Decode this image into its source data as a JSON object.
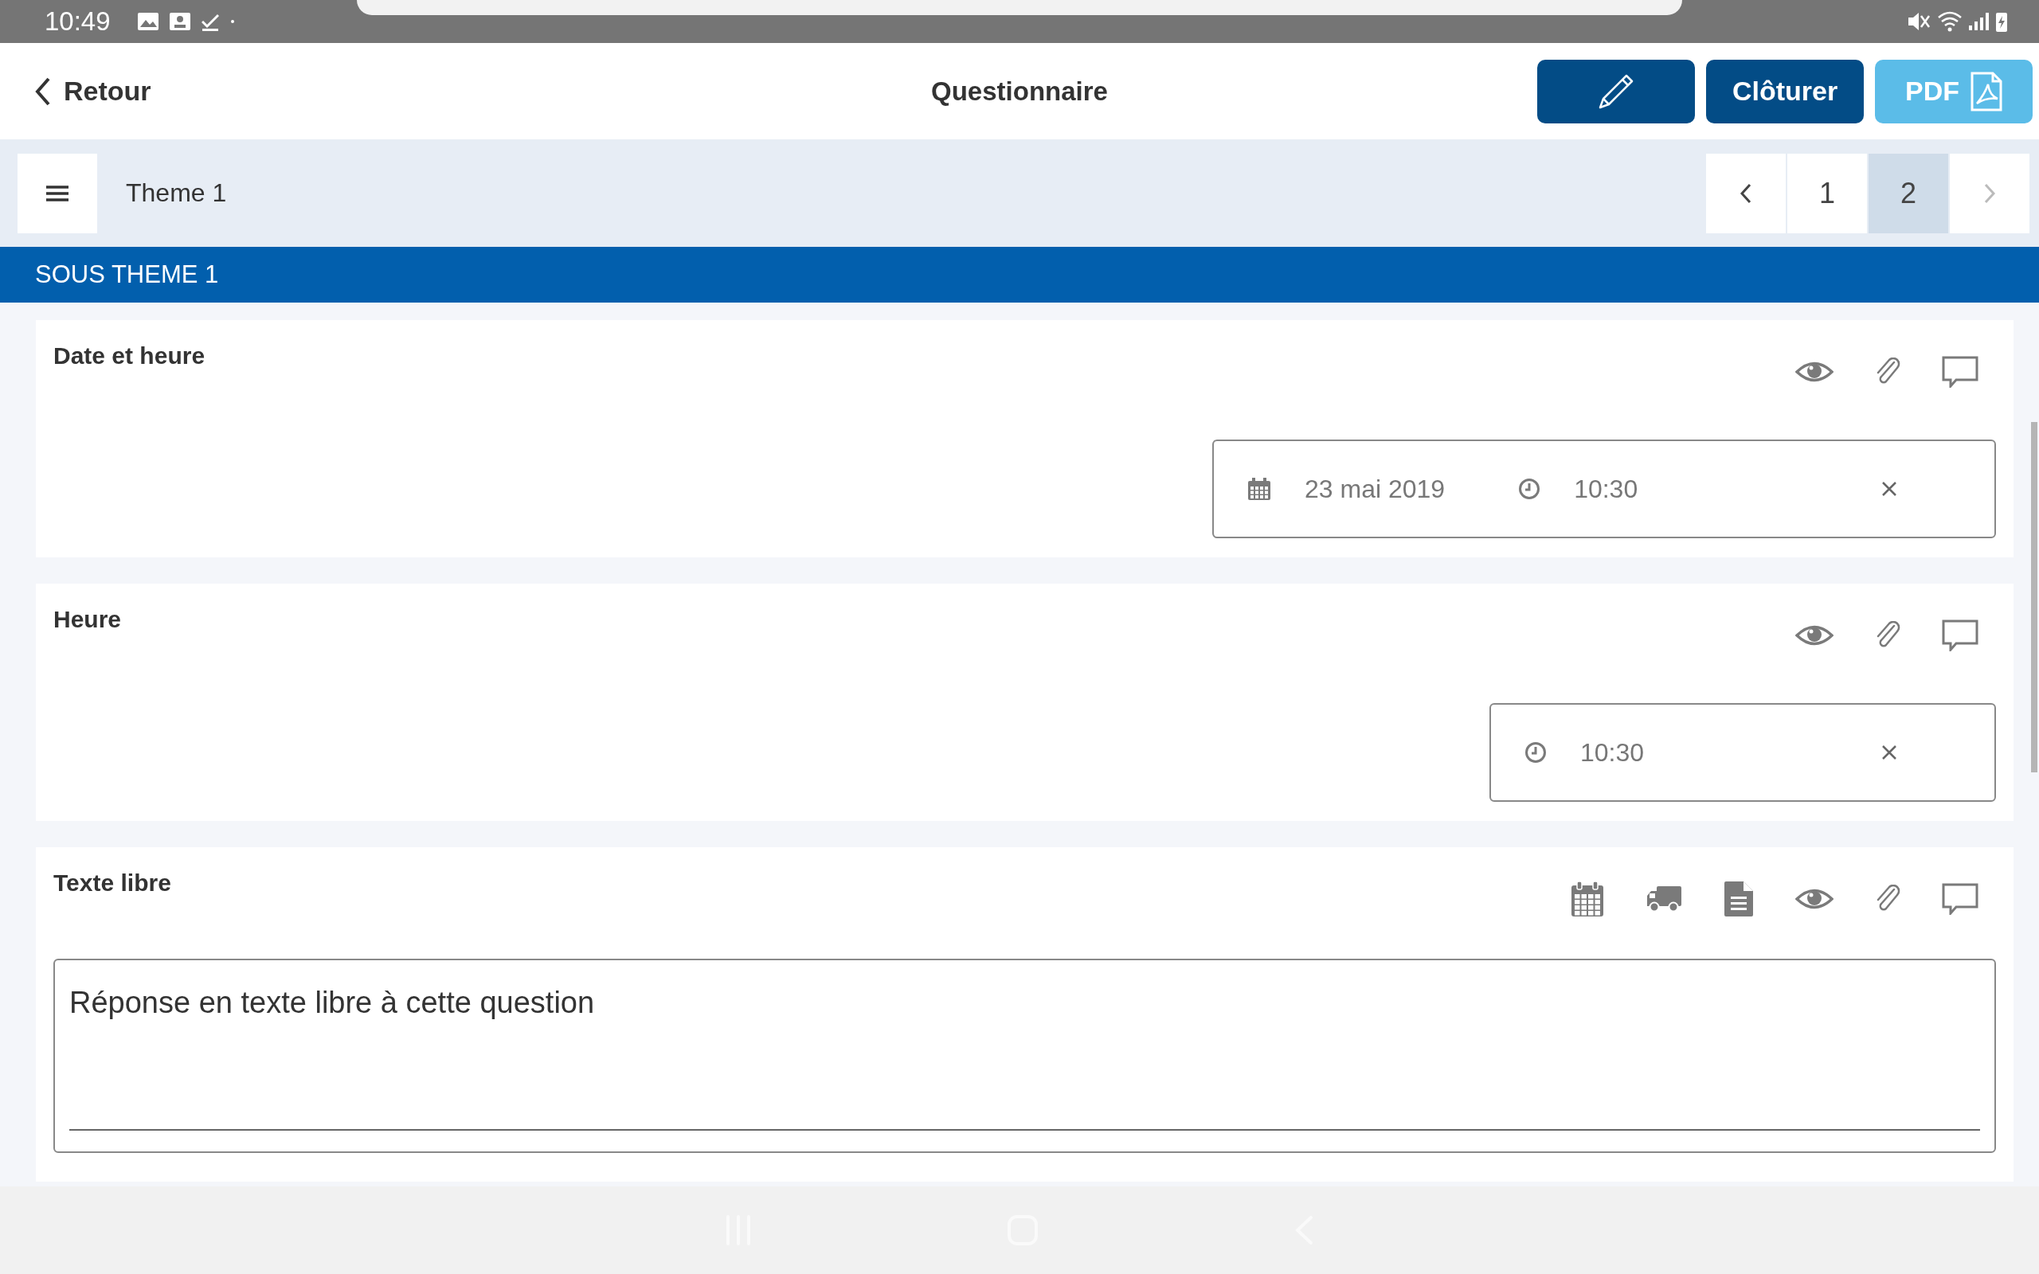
{
  "status_bar": {
    "time": "10:49"
  },
  "header": {
    "back_label": "Retour",
    "title": "Questionnaire",
    "buttons": [
      {
        "kind": "edit"
      },
      {
        "kind": "close",
        "label": "Clôturer"
      },
      {
        "kind": "pdf",
        "label": "PDF"
      }
    ]
  },
  "theme_bar": {
    "title": "Theme 1",
    "prev": {
      "disabled": false
    },
    "pages": [
      {
        "label": "1",
        "selected": false
      },
      {
        "label": "2",
        "selected": true
      }
    ],
    "next": {
      "disabled": true
    }
  },
  "section": {
    "title": "SOUS THEME 1"
  },
  "questions": [
    {
      "kind": "datetime",
      "title": "Date et heure",
      "actions": [
        {
          "kind": "eye"
        },
        {
          "kind": "clip"
        },
        {
          "kind": "comment"
        }
      ],
      "date": "23 mai 2019",
      "time": "10:30"
    },
    {
      "kind": "time",
      "title": "Heure",
      "actions": [
        {
          "kind": "eye"
        },
        {
          "kind": "clip"
        },
        {
          "kind": "comment"
        }
      ],
      "time": "10:30"
    },
    {
      "kind": "text",
      "title": "Texte libre",
      "actions": [
        {
          "kind": "calendar"
        },
        {
          "kind": "truck"
        },
        {
          "kind": "document"
        },
        {
          "kind": "eye"
        },
        {
          "kind": "clip"
        },
        {
          "kind": "comment"
        }
      ],
      "value": "Réponse en texte libre à cette question"
    }
  ]
}
